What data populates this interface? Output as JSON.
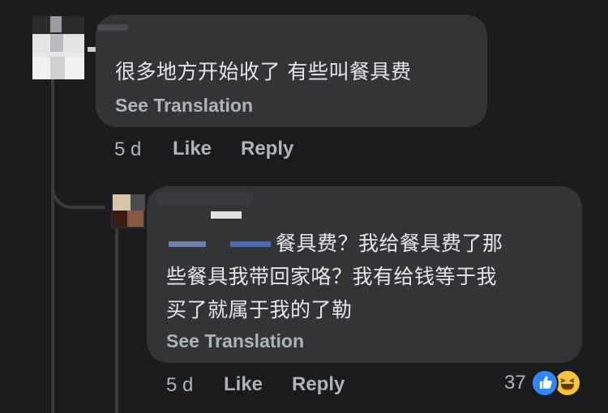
{
  "comment1": {
    "text": "很多地方开始收了 有些叫餐具费",
    "see_translation": "See Translation",
    "time": "5 d",
    "like": "Like",
    "reply": "Reply"
  },
  "comment2": {
    "text_line1": "餐具费？我给餐具费了那",
    "text_line2": "些餐具我带回家咯？我有给钱等于我",
    "text_line3": "买了就属于我的了勒",
    "see_translation": "See Translation",
    "time": "5 d",
    "like": "Like",
    "reply": "Reply",
    "reaction_count": "37",
    "reaction_icons": [
      "like-icon",
      "haha-icon"
    ]
  },
  "colors": {
    "background": "#1a1b1d",
    "bubble": "#333436",
    "text": "#e4e6eb",
    "secondary": "#b0b3b8",
    "like_blue": "#2d88ff",
    "haha_yellow": "#f7c33b"
  }
}
